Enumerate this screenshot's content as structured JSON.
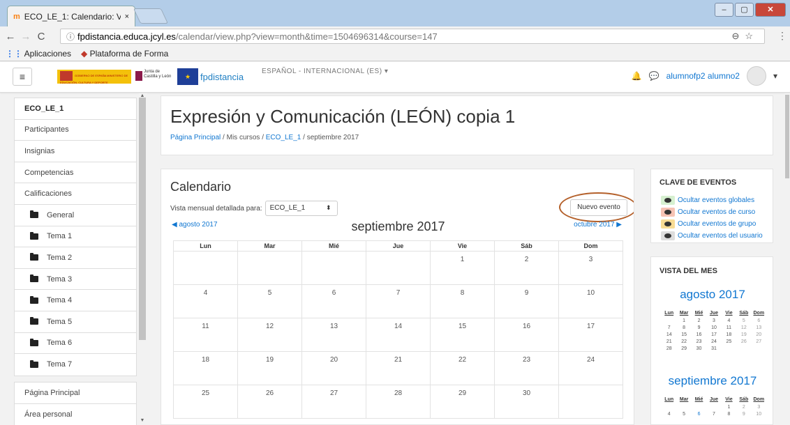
{
  "browser": {
    "tab_favicon": "m",
    "tab_title": "ECO_LE_1: Calendario: Vi",
    "tab_close": "×",
    "win_min": "–",
    "win_max": "▢",
    "win_close": "✕",
    "url_host": "fpdistancia.educa.jcyl.es",
    "url_path": "/calendar/view.php?view=month&time=1504696314&course=147",
    "url_icons": "⊖☆",
    "back": "←",
    "forward": "→",
    "reload": "C",
    "info": "ⓘ",
    "menu": "⋮",
    "bookmarks": [
      {
        "icon": "⋮⋮",
        "label": "Aplicaciones"
      },
      {
        "icon": "◆",
        "label": "Plataforma de Forma"
      }
    ]
  },
  "navbar": {
    "menu_icon": "≡",
    "gob_text": "GOBIERNO DE ESPAÑA MINISTERIO DE EDUCACIÓN, CULTURA Y DEPORTE",
    "jcyl_text": "Junta de Castilla y León",
    "eu_text": "★",
    "site_name": "fpdistancia",
    "language": "ESPAÑOL - INTERNACIONAL (ES) ▾",
    "bell": "🔔",
    "chat": "💬",
    "username": "alumnofp2 alumno2",
    "user_caret": "▾"
  },
  "sidebar": {
    "items": [
      {
        "label": "ECO_LE_1"
      },
      {
        "label": "Participantes"
      },
      {
        "label": "Insignias"
      },
      {
        "label": "Competencias"
      },
      {
        "label": "Calificaciones"
      },
      {
        "label": "General"
      },
      {
        "label": "Tema 1"
      },
      {
        "label": "Tema 2"
      },
      {
        "label": "Tema 3"
      },
      {
        "label": "Tema 4"
      },
      {
        "label": "Tema 5"
      },
      {
        "label": "Tema 6"
      },
      {
        "label": "Tema 7"
      }
    ],
    "items2": [
      {
        "label": "Página Principal"
      },
      {
        "label": "Área personal"
      }
    ]
  },
  "header": {
    "title": "Expresión y Comunicación (LEÓN) copia 1",
    "breadcrumb": [
      {
        "label": "Página Principal"
      },
      {
        "sep": " / "
      },
      {
        "label": "Mis cursos"
      },
      {
        "label": "ECO_LE_1"
      },
      {
        "label": "septiembre 2017"
      }
    ]
  },
  "calendar": {
    "title": "Calendario",
    "vista_label": "Vista mensual detallada para:",
    "course_select": "ECO_LE_1",
    "select_arrow": "⬍",
    "new_event": "Nuevo evento",
    "prev_month": "◀ agosto 2017",
    "next_month": "octubre 2017 ▶",
    "current_month": "septiembre 2017",
    "days": [
      "Lun",
      "Mar",
      "Mié",
      "Jue",
      "Vie",
      "Sáb",
      "Dom"
    ],
    "weeks": [
      [
        "",
        "",
        "",
        "",
        "1",
        "2",
        "3"
      ],
      [
        "4",
        "5",
        "6",
        "7",
        "8",
        "9",
        "10"
      ],
      [
        "11",
        "12",
        "13",
        "14",
        "15",
        "16",
        "17"
      ],
      [
        "18",
        "19",
        "20",
        "21",
        "22",
        "23",
        "24"
      ],
      [
        "25",
        "26",
        "27",
        "28",
        "29",
        "30",
        ""
      ]
    ]
  },
  "clave": {
    "title": "CLAVE DE EVENTOS",
    "items": [
      {
        "label": "Ocultar eventos globales",
        "color": "#d6f0d0"
      },
      {
        "label": "Ocultar eventos de curso",
        "color": "#f6c3b4"
      },
      {
        "label": "Ocultar eventos de grupo",
        "color": "#f8dc94"
      },
      {
        "label": "Ocultar eventos del usuario",
        "color": "#dddddd"
      }
    ]
  },
  "vista_mes": {
    "title": "VISTA DEL MES",
    "days": [
      "Lun",
      "Mar",
      "Mié",
      "Jue",
      "Vie",
      "Sáb",
      "Dom"
    ],
    "months": [
      {
        "name": "agosto 2017",
        "weeks": [
          [
            "",
            "1",
            "2",
            "3",
            "4",
            "5",
            "6"
          ],
          [
            "7",
            "8",
            "9",
            "10",
            "11",
            "12",
            "13"
          ],
          [
            "14",
            "15",
            "16",
            "17",
            "18",
            "19",
            "20"
          ],
          [
            "21",
            "22",
            "23",
            "24",
            "25",
            "26",
            "27"
          ],
          [
            "28",
            "29",
            "30",
            "31",
            "",
            "",
            ""
          ]
        ]
      },
      {
        "name": "septiembre 2017",
        "weeks": [
          [
            "",
            "",
            "",
            "",
            "1",
            "2",
            "3"
          ],
          [
            "4",
            "5",
            "6",
            "7",
            "8",
            "9",
            "10"
          ]
        ]
      }
    ]
  }
}
